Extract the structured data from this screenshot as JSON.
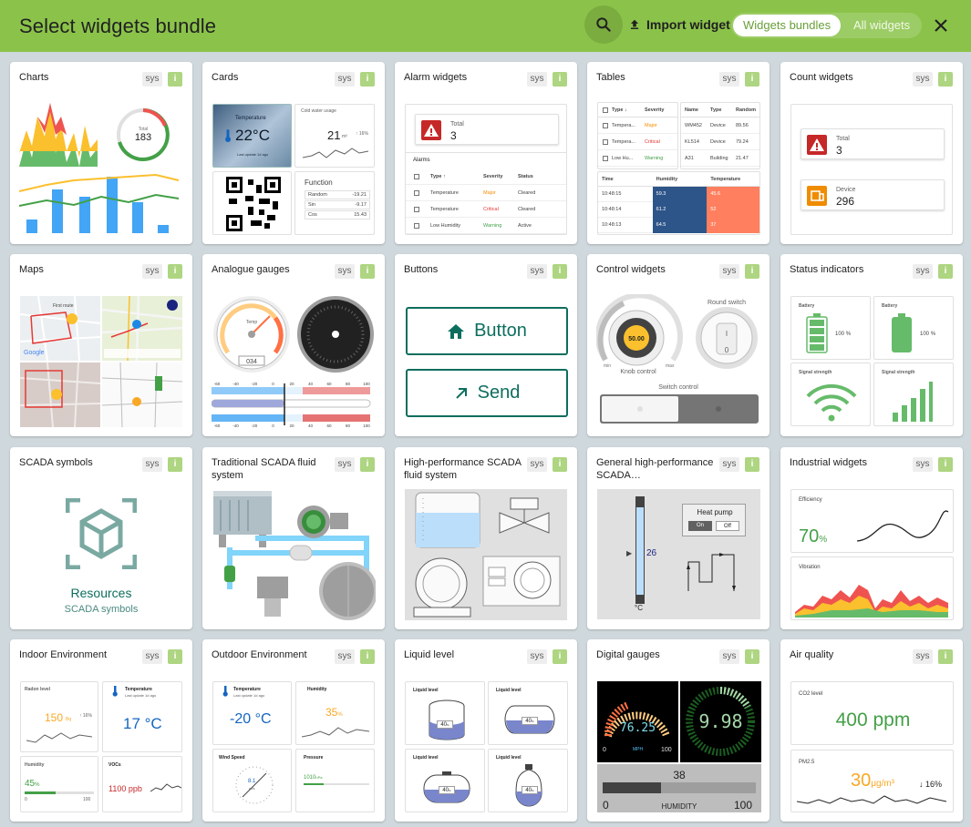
{
  "header": {
    "title": "Select widgets bundle",
    "import_label": "Import widget",
    "tab_active": "Widgets bundles",
    "tab_inactive": "All widgets"
  },
  "badges": {
    "sys": "sys",
    "info": "i"
  },
  "colors": {
    "accent": "#8bc34a",
    "teal": "#0d6e5e",
    "critical": "#e53935",
    "major": "#fb8c00",
    "warning": "#43a047"
  },
  "cards": [
    {
      "title": "Charts"
    },
    {
      "title": "Cards"
    },
    {
      "title": "Alarm widgets"
    },
    {
      "title": "Tables"
    },
    {
      "title": "Count widgets"
    },
    {
      "title": "Maps"
    },
    {
      "title": "Analogue gauges"
    },
    {
      "title": "Buttons"
    },
    {
      "title": "Control widgets"
    },
    {
      "title": "Status indicators"
    },
    {
      "title": "SCADA symbols"
    },
    {
      "title": "Traditional SCADA fluid system"
    },
    {
      "title": "High-performance SCADA fluid system"
    },
    {
      "title": "General high-performance SCADA…"
    },
    {
      "title": "Industrial widgets"
    },
    {
      "title": "Indoor Environment"
    },
    {
      "title": "Outdoor Environment"
    },
    {
      "title": "Liquid level"
    },
    {
      "title": "Digital gauges"
    },
    {
      "title": "Air quality"
    }
  ],
  "previews": {
    "charts": {
      "donut_label": "Total",
      "donut_value": "183"
    },
    "cards": {
      "temp_label": "Temperature",
      "temp_value": "22°C",
      "temp_sub": "Last update 1d ago",
      "water_label": "Cold water usage",
      "water_value": "21",
      "water_unit": "m³",
      "water_change": "↑ 16%",
      "func_title": "Function",
      "func_rows": [
        [
          "Random",
          "-19.21"
        ],
        [
          "Sin",
          "-9.17"
        ],
        [
          "Cos",
          "15.43"
        ]
      ]
    },
    "alarm": {
      "total_label": "Total",
      "total_value": "3",
      "alarms_label": "Alarms",
      "cols": [
        "Type ↑",
        "Severity",
        "Status"
      ],
      "rows": [
        [
          "Temperature",
          "Major",
          "Cleared"
        ],
        [
          "Temperature",
          "Critical",
          "Cleared"
        ],
        [
          "Low Humidity",
          "Warning",
          "Active"
        ]
      ]
    },
    "tables": {
      "t1_cols": [
        "Type ↓",
        "Severity"
      ],
      "t1_rows": [
        [
          "Tempera...",
          "Major"
        ],
        [
          "Tempera...",
          "Critical"
        ],
        [
          "Low Hu...",
          "Warning"
        ]
      ],
      "t2_cols": [
        "Name",
        "Type",
        "Random"
      ],
      "t2_rows": [
        [
          "WM452",
          "Device",
          "89.56"
        ],
        [
          "KL514",
          "Device",
          "79.24"
        ],
        [
          "A31",
          "Building",
          "21.47"
        ]
      ],
      "t3_cols": [
        "Time",
        "Humidity",
        "Temperature"
      ],
      "t3_rows": [
        [
          "10:48:15",
          "59.3",
          "45.6"
        ],
        [
          "10:48:14",
          "61.2",
          "52"
        ],
        [
          "10:48:13",
          "64.5",
          "37"
        ]
      ]
    },
    "count": {
      "c1_label": "Total",
      "c1_value": "3",
      "c2_label": "Device",
      "c2_value": "296"
    },
    "maps": {
      "route_label": "First route",
      "google": "Google"
    },
    "gauges": {
      "temp_label": "Temp",
      "odometer": "034",
      "scale": [
        "-60",
        "-40",
        "-20",
        "0",
        "20",
        "40",
        "60",
        "80",
        "100"
      ]
    },
    "buttons": {
      "b1": "Button",
      "b2": "Send"
    },
    "control": {
      "knob_value": "50.00",
      "knob_label": "Knob control",
      "min": "min",
      "max": "max",
      "round_label": "Round switch",
      "switch_label": "Switch control",
      "sw_on": "I",
      "sw_off": "0"
    },
    "status": {
      "battery1": "Battery",
      "battery1_value": "100",
      "battery2": "Battery",
      "battery2_value": "100",
      "pct": "%",
      "signal1": "Signal strength",
      "signal2": "Signal strength"
    },
    "scada": {
      "res_title": "Resources",
      "res_sub": "SCADA symbols"
    },
    "general_hp": {
      "heat_pump": "Heat pump",
      "on": "On",
      "off": "Off",
      "level": "26",
      "unit": "°C"
    },
    "industrial": {
      "eff_label": "Efficiency",
      "eff_value": "70",
      "eff_unit": "%",
      "vib_label": "Vibration"
    },
    "indoor": {
      "radon_label": "Radon level",
      "radon_value": "150",
      "radon_unit": "Bq",
      "radon_change": "↑ 16%",
      "temp_label": "Temperature",
      "temp_sub": "Last update 1d ago",
      "temp_value": "17 °C",
      "hum_label": "Humidity",
      "hum_value": "45",
      "hum_unit": "%",
      "hum_min": "0",
      "hum_max": "100",
      "voc_label": "VOCs",
      "voc_value": "1100 ppb"
    },
    "outdoor": {
      "temp_label": "Temperature",
      "temp_sub": "Last update 1d ago",
      "temp_value": "-20 °C",
      "hum_label": "Humidity",
      "hum_value": "35",
      "hum_unit": "%",
      "wind_label": "Wind Speed",
      "wind_value": "8.1",
      "wind_unit": "m/s",
      "press_label": "Pressure",
      "press_value": "1010",
      "press_unit": "hPa"
    },
    "liquid": {
      "label": "Liquid level",
      "value": "40",
      "unit": "%"
    },
    "digital": {
      "speed": "76.25",
      "speed_unit": "MPH",
      "speed_min": "0",
      "speed_max": "100",
      "big": "9.98",
      "bar_value": "38",
      "bar_min": "0",
      "bar_max": "100",
      "bar_label": "HUMIDITY"
    },
    "air": {
      "co2_label": "CO2 level",
      "co2_value": "400 ppm",
      "pm_label": "PM2.5",
      "pm_value": "30",
      "pm_unit": "μg/m³",
      "pm_change": "↓ 16%"
    }
  }
}
